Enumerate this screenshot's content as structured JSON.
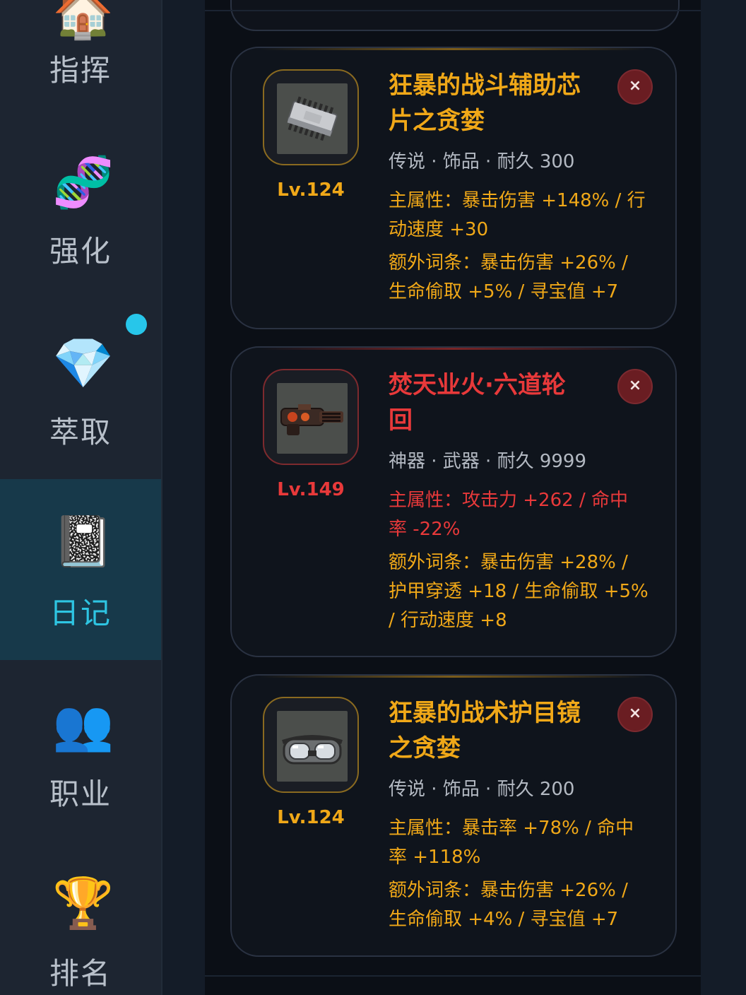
{
  "sidebar": {
    "items": [
      {
        "label": "指挥",
        "icon": "house-icon",
        "glyph": "🏠"
      },
      {
        "label": "强化",
        "icon": "dna-icon",
        "glyph": "🧬"
      },
      {
        "label": "萃取",
        "icon": "gem-icon",
        "glyph": "💎"
      },
      {
        "label": "日记",
        "icon": "notebook-icon",
        "glyph": "📓"
      },
      {
        "label": "职业",
        "icon": "people-icon",
        "glyph": "👥"
      },
      {
        "label": "排名",
        "icon": "trophy-icon",
        "glyph": "🏆"
      }
    ],
    "active_index": 3
  },
  "cards": [
    {
      "level": "Lv.124",
      "title_line1": "狂暴的战斗辅助芯",
      "title_line2": "片之贪婪",
      "meta": "传说 · 饰品 · 耐久 300",
      "attr_line1": "主属性：暴击伤害 +148% / 行",
      "attr_line2": "动速度 +30",
      "extra_line1": "额外词条：暴击伤害 +26% /",
      "extra_line2": "生命偷取 +5% / 寻宝值 +7",
      "extra_line3": "",
      "close_label": "×",
      "item_icon": "chip-icon",
      "rarity_color": "#f0a818"
    },
    {
      "level": "Lv.149",
      "title_line1": "焚天业火·六道轮",
      "title_line2": "回",
      "meta": "神器 · 武器 · 耐久 9999",
      "attr_line1": "主属性：攻击力 +262 / 命中",
      "attr_line2": "率 -22%",
      "extra_line1": "额外词条：暴击伤害 +28% /",
      "extra_line2": "护甲穿透 +18 / 生命偷取 +5%",
      "extra_line3": "/ 行动速度 +8",
      "close_label": "×",
      "item_icon": "gatling-gun-icon",
      "rarity_color": "#e8393a"
    },
    {
      "level": "Lv.124",
      "title_line1": "狂暴的战术护目镜",
      "title_line2": "之贪婪",
      "meta": "传说 · 饰品 · 耐久 200",
      "attr_line1": "主属性：暴击率 +78% / 命中",
      "attr_line2": "率 +118%",
      "extra_line1": "额外词条：暴击伤害 +26% /",
      "extra_line2": "生命偷取 +4% / 寻宝值 +7",
      "extra_line3": "",
      "close_label": "×",
      "item_icon": "goggles-icon",
      "rarity_color": "#f0a818"
    }
  ]
}
